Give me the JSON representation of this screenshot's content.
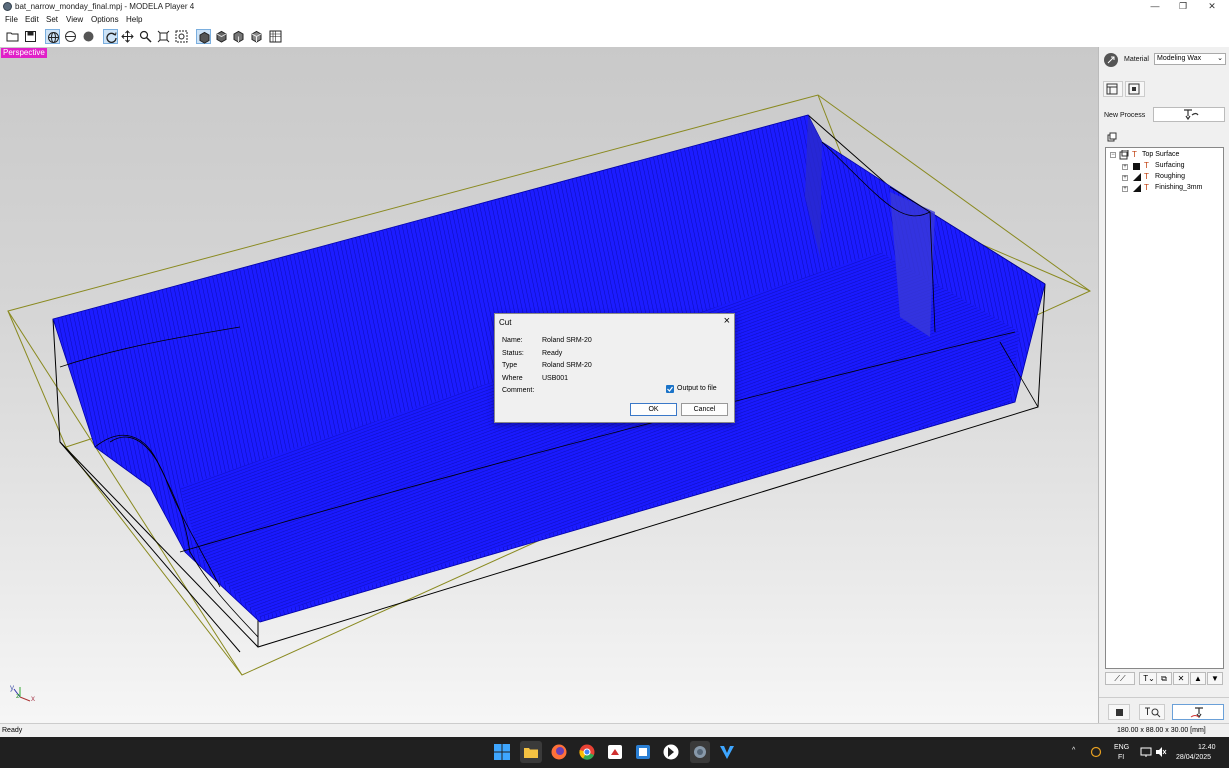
{
  "window": {
    "title": "bat_narrow_monday_final.mpj - MODELA Player 4",
    "minimize": "—",
    "maximize": "❐",
    "close": "✕"
  },
  "menu": [
    "File",
    "Edit",
    "Set",
    "View",
    "Options",
    "Help"
  ],
  "viewport": {
    "view_label": "Perspective",
    "axis_labels": {
      "y": "y",
      "x": "x",
      "z": "z"
    }
  },
  "panel": {
    "material_label": "Material",
    "material_value": "Modeling Wax",
    "new_process_label": "New Process",
    "tree": [
      {
        "label": "Top Surface",
        "level": 0
      },
      {
        "label": "Surfacing",
        "level": 1
      },
      {
        "label": "Roughing",
        "level": 1
      },
      {
        "label": "Finishing_3mm",
        "level": 1
      }
    ]
  },
  "status": {
    "left": "Ready",
    "right": "180.00 x 88.00 x 30.00 [mm]"
  },
  "dialog": {
    "title": "Cut",
    "fields": [
      {
        "label": "Name:",
        "value": "Roland SRM-20"
      },
      {
        "label": "Status:",
        "value": "Ready"
      },
      {
        "label": "Type",
        "value": "Roland SRM-20"
      },
      {
        "label": "Where",
        "value": "USB001"
      },
      {
        "label": "Comment:",
        "value": ""
      }
    ],
    "output_to_file_label": "Output to file",
    "output_to_file_checked": true,
    "ok_label": "OK",
    "cancel_label": "Cancel"
  },
  "taskbar": {
    "lang": "ENG",
    "region": "FI",
    "time": "12.40",
    "date": "28/04/2025",
    "chevron": "^"
  },
  "colors": {
    "toolpath_blue": "#1a1aff",
    "perspective_badge": "#e020c8",
    "bounding_box": "#8a8a20"
  }
}
